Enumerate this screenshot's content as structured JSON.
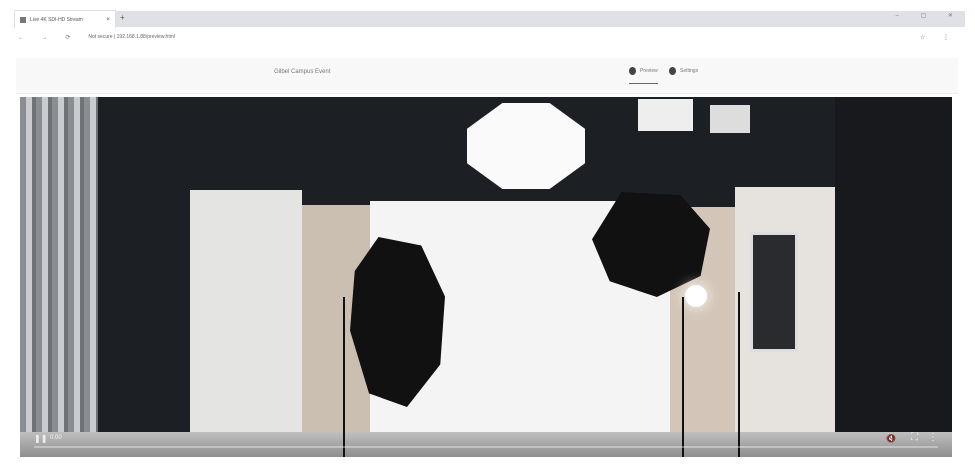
{
  "browser": {
    "tab_title": "Live 4K SDI-HD Stream",
    "new_tab": "+",
    "close": "×",
    "url": "Not secure | 192.168.1.88/preview.html",
    "nav": "← → ⟳",
    "window_controls": "– ▢ ✕",
    "right_icons": "☆ ⋮"
  },
  "header": {
    "title": "Gilbel Campus Event",
    "tabs": [
      {
        "label": "Preview",
        "icon": "location-pin-icon"
      },
      {
        "label": "Settings",
        "icon": "gear-icon"
      }
    ]
  },
  "player": {
    "play_icon": "❚❚",
    "time": "0:00",
    "mute_icon": "🔇",
    "fullscreen_icon": "⛶",
    "menu_icon": "⋮"
  }
}
